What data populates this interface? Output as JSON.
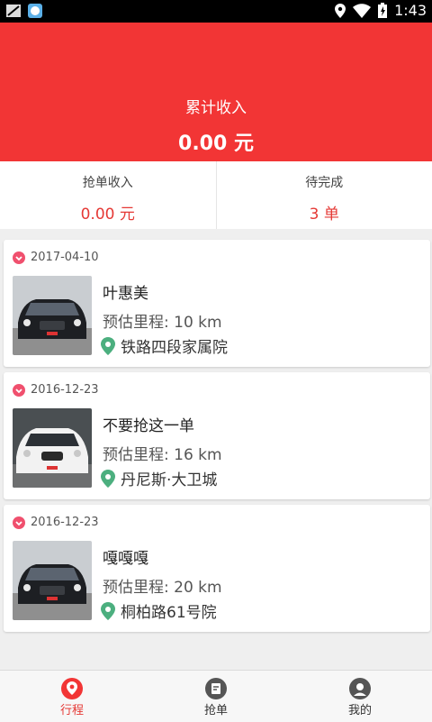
{
  "status_bar": {
    "time": "1:43"
  },
  "summary": {
    "label": "累计收入",
    "value": "0.00 元"
  },
  "stats": [
    {
      "title": "抢单收入",
      "value": "0.00 元"
    },
    {
      "title": "待完成",
      "value": "3 单"
    }
  ],
  "trips": [
    {
      "date": "2017-04-10",
      "name": "叶惠美",
      "distance": "预估里程: 10 km",
      "address": "铁路四段家属院",
      "car_color": "dark"
    },
    {
      "date": "2016-12-23",
      "name": "不要抢这一单",
      "distance": "预估里程: 16 km",
      "address": "丹尼斯·大卫城",
      "car_color": "white"
    },
    {
      "date": "2016-12-23",
      "name": "嘎嘎嘎",
      "distance": "预估里程: 20 km",
      "address": "桐柏路61号院",
      "car_color": "dark"
    }
  ],
  "tabs": [
    {
      "label": "行程",
      "active": true
    },
    {
      "label": "抢单",
      "active": false
    },
    {
      "label": "我的",
      "active": false
    }
  ],
  "colors": {
    "accent": "#f23535",
    "pin": "#4caf7f"
  }
}
